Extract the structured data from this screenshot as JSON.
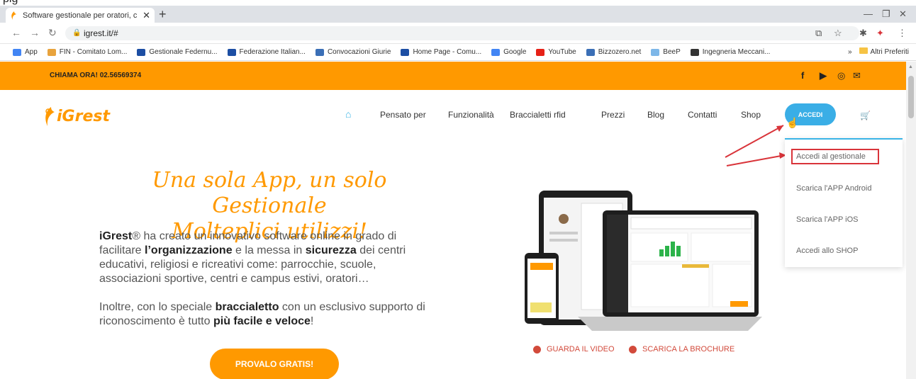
{
  "browser": {
    "top_strip_text": "pig",
    "tab_title": "Software gestionale per oratori, c",
    "url": "igrest.it/#",
    "bookmarks": [
      {
        "label": "App",
        "color": "#4285f4"
      },
      {
        "label": "FIN - Comitato Lom...",
        "color": "#e8a33d"
      },
      {
        "label": "Gestionale Federnu...",
        "color": "#1c4ea3"
      },
      {
        "label": "Federazione Italian...",
        "color": "#1c4ea3"
      },
      {
        "label": "Convocazioni Giurie",
        "color": "#3b6fb6"
      },
      {
        "label": "Home Page - Comu...",
        "color": "#1c4ea3"
      },
      {
        "label": "Google",
        "color": "#4285f4"
      },
      {
        "label": "YouTube",
        "color": "#e62117"
      },
      {
        "label": "Bizzozero.net",
        "color": "#3b6fb6"
      },
      {
        "label": "BeeP",
        "color": "#7db7e8"
      },
      {
        "label": "Ingegneria Meccani...",
        "color": "#333333"
      }
    ],
    "more_label": "»",
    "other_bookmarks": "Altri Preferiti"
  },
  "site": {
    "phone": "CHIAMA ORA! 02.56569374",
    "logo_text": "iGrest",
    "menu": [
      "Pensato per",
      "Funzionalità",
      "Braccialetti rfid",
      "Prezzi",
      "Blog",
      "Contatti",
      "Shop"
    ],
    "accedi": "ACCEDI",
    "dropdown": [
      "Accedi al gestionale",
      "Scarica l'APP Android",
      "Scarica l'APP iOS",
      "Accedi allo SHOP"
    ],
    "headline_1": "Una sola App, un solo Gestionale",
    "headline_2": "Molteplici utilizzi!",
    "p1_a": "iGrest",
    "p1_b": "® ha creato un innovativo software online in grado di facilitare ",
    "p1_c": "l’organizzazione",
    "p1_d": " e la messa in ",
    "p1_e": "sicurezza",
    "p1_f": " dei centri educativi, religiosi e ricreativi come: parrocchie, scuole, associazioni sportive, centri e campus estivi, oratori…",
    "p2_a": "Inoltre, con lo speciale ",
    "p2_b": "braccialetto",
    "p2_c": " con un esclusivo supporto di riconoscimento è tutto ",
    "p2_d": "più facile e veloce",
    "p2_e": "!",
    "cta": "PROVALO GRATIS!",
    "video": "GUARDA IL VIDEO",
    "brochure": "SCARICA LA BROCHURE"
  },
  "colors": {
    "brand_orange": "#ff9900",
    "accent_blue": "#3aaee6",
    "highlight_red": "#d9343a"
  }
}
